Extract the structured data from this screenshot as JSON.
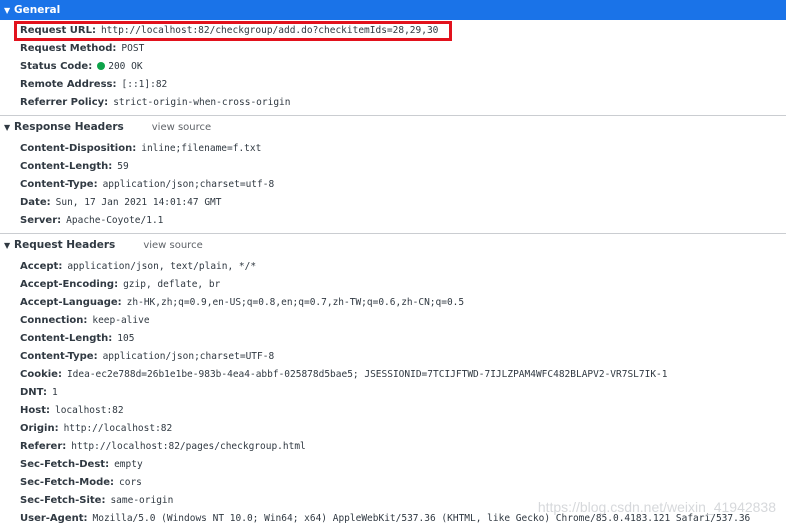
{
  "general": {
    "title": "General",
    "rows": [
      {
        "name": "Request URL:",
        "value": "http://localhost:82/checkgroup/add.do?checkitemIds=28,29,30"
      },
      {
        "name": "Request Method:",
        "value": "POST"
      },
      {
        "name": "Status Code:",
        "value": "200 OK",
        "status_color": "#0ea34a"
      },
      {
        "name": "Remote Address:",
        "value": "[::1]:82"
      },
      {
        "name": "Referrer Policy:",
        "value": "strict-origin-when-cross-origin"
      }
    ]
  },
  "response_headers": {
    "title": "Response Headers",
    "view_source": "view source",
    "rows": [
      {
        "name": "Content-Disposition:",
        "value": "inline;filename=f.txt"
      },
      {
        "name": "Content-Length:",
        "value": "59"
      },
      {
        "name": "Content-Type:",
        "value": "application/json;charset=utf-8"
      },
      {
        "name": "Date:",
        "value": "Sun, 17 Jan 2021 14:01:47 GMT"
      },
      {
        "name": "Server:",
        "value": "Apache-Coyote/1.1"
      }
    ]
  },
  "request_headers": {
    "title": "Request Headers",
    "view_source": "view source",
    "rows": [
      {
        "name": "Accept:",
        "value": "application/json, text/plain, */*"
      },
      {
        "name": "Accept-Encoding:",
        "value": "gzip, deflate, br"
      },
      {
        "name": "Accept-Language:",
        "value": "zh-HK,zh;q=0.9,en-US;q=0.8,en;q=0.7,zh-TW;q=0.6,zh-CN;q=0.5"
      },
      {
        "name": "Connection:",
        "value": "keep-alive"
      },
      {
        "name": "Content-Length:",
        "value": "105"
      },
      {
        "name": "Content-Type:",
        "value": "application/json;charset=UTF-8"
      },
      {
        "name": "Cookie:",
        "value": "Idea-ec2e788d=26b1e1be-983b-4ea4-abbf-025878d5bae5; JSESSIONID=7TCIJFTWD-7IJLZPAM4WFC482BLAPV2-VR7SL7IK-1"
      },
      {
        "name": "DNT:",
        "value": "1"
      },
      {
        "name": "Host:",
        "value": "localhost:82"
      },
      {
        "name": "Origin:",
        "value": "http://localhost:82"
      },
      {
        "name": "Referer:",
        "value": "http://localhost:82/pages/checkgroup.html"
      },
      {
        "name": "Sec-Fetch-Dest:",
        "value": "empty"
      },
      {
        "name": "Sec-Fetch-Mode:",
        "value": "cors"
      },
      {
        "name": "Sec-Fetch-Site:",
        "value": "same-origin"
      },
      {
        "name": "User-Agent:",
        "value": "Mozilla/5.0 (Windows NT 10.0; Win64; x64) AppleWebKit/537.36 (KHTML, like Gecko) Chrome/85.0.4183.121 Safari/537.36"
      }
    ]
  },
  "watermark": "https://blog.csdn.net/weixin_41942838",
  "colors": {
    "selected_header_bg": "#1a73e8",
    "highlight_border": "#e2121d",
    "status_ok": "#0ea34a"
  }
}
